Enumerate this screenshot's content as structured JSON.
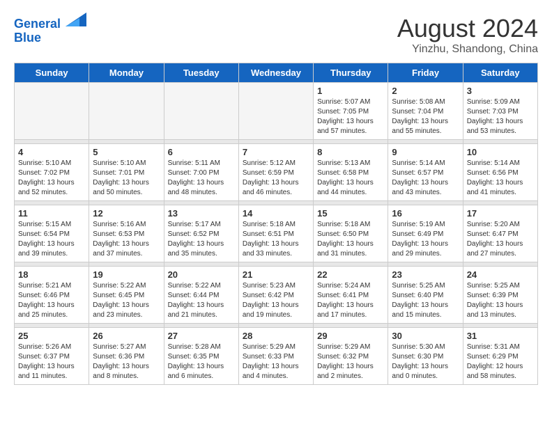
{
  "header": {
    "logo_line1": "General",
    "logo_line2": "Blue",
    "main_title": "August 2024",
    "subtitle": "Yinzhu, Shandong, China"
  },
  "weekdays": [
    "Sunday",
    "Monday",
    "Tuesday",
    "Wednesday",
    "Thursday",
    "Friday",
    "Saturday"
  ],
  "weeks": [
    [
      {
        "num": "",
        "empty": true
      },
      {
        "num": "",
        "empty": true
      },
      {
        "num": "",
        "empty": true
      },
      {
        "num": "",
        "empty": true
      },
      {
        "num": "1",
        "sunrise": "5:07 AM",
        "sunset": "7:05 PM",
        "daylight": "13 hours and 57 minutes."
      },
      {
        "num": "2",
        "sunrise": "5:08 AM",
        "sunset": "7:04 PM",
        "daylight": "13 hours and 55 minutes."
      },
      {
        "num": "3",
        "sunrise": "5:09 AM",
        "sunset": "7:03 PM",
        "daylight": "13 hours and 53 minutes."
      }
    ],
    [
      {
        "num": "4",
        "sunrise": "5:10 AM",
        "sunset": "7:02 PM",
        "daylight": "13 hours and 52 minutes."
      },
      {
        "num": "5",
        "sunrise": "5:10 AM",
        "sunset": "7:01 PM",
        "daylight": "13 hours and 50 minutes."
      },
      {
        "num": "6",
        "sunrise": "5:11 AM",
        "sunset": "7:00 PM",
        "daylight": "13 hours and 48 minutes."
      },
      {
        "num": "7",
        "sunrise": "5:12 AM",
        "sunset": "6:59 PM",
        "daylight": "13 hours and 46 minutes."
      },
      {
        "num": "8",
        "sunrise": "5:13 AM",
        "sunset": "6:58 PM",
        "daylight": "13 hours and 44 minutes."
      },
      {
        "num": "9",
        "sunrise": "5:14 AM",
        "sunset": "6:57 PM",
        "daylight": "13 hours and 43 minutes."
      },
      {
        "num": "10",
        "sunrise": "5:14 AM",
        "sunset": "6:56 PM",
        "daylight": "13 hours and 41 minutes."
      }
    ],
    [
      {
        "num": "11",
        "sunrise": "5:15 AM",
        "sunset": "6:54 PM",
        "daylight": "13 hours and 39 minutes."
      },
      {
        "num": "12",
        "sunrise": "5:16 AM",
        "sunset": "6:53 PM",
        "daylight": "13 hours and 37 minutes."
      },
      {
        "num": "13",
        "sunrise": "5:17 AM",
        "sunset": "6:52 PM",
        "daylight": "13 hours and 35 minutes."
      },
      {
        "num": "14",
        "sunrise": "5:18 AM",
        "sunset": "6:51 PM",
        "daylight": "13 hours and 33 minutes."
      },
      {
        "num": "15",
        "sunrise": "5:18 AM",
        "sunset": "6:50 PM",
        "daylight": "13 hours and 31 minutes."
      },
      {
        "num": "16",
        "sunrise": "5:19 AM",
        "sunset": "6:49 PM",
        "daylight": "13 hours and 29 minutes."
      },
      {
        "num": "17",
        "sunrise": "5:20 AM",
        "sunset": "6:47 PM",
        "daylight": "13 hours and 27 minutes."
      }
    ],
    [
      {
        "num": "18",
        "sunrise": "5:21 AM",
        "sunset": "6:46 PM",
        "daylight": "13 hours and 25 minutes."
      },
      {
        "num": "19",
        "sunrise": "5:22 AM",
        "sunset": "6:45 PM",
        "daylight": "13 hours and 23 minutes."
      },
      {
        "num": "20",
        "sunrise": "5:22 AM",
        "sunset": "6:44 PM",
        "daylight": "13 hours and 21 minutes."
      },
      {
        "num": "21",
        "sunrise": "5:23 AM",
        "sunset": "6:42 PM",
        "daylight": "13 hours and 19 minutes."
      },
      {
        "num": "22",
        "sunrise": "5:24 AM",
        "sunset": "6:41 PM",
        "daylight": "13 hours and 17 minutes."
      },
      {
        "num": "23",
        "sunrise": "5:25 AM",
        "sunset": "6:40 PM",
        "daylight": "13 hours and 15 minutes."
      },
      {
        "num": "24",
        "sunrise": "5:25 AM",
        "sunset": "6:39 PM",
        "daylight": "13 hours and 13 minutes."
      }
    ],
    [
      {
        "num": "25",
        "sunrise": "5:26 AM",
        "sunset": "6:37 PM",
        "daylight": "13 hours and 11 minutes."
      },
      {
        "num": "26",
        "sunrise": "5:27 AM",
        "sunset": "6:36 PM",
        "daylight": "13 hours and 8 minutes."
      },
      {
        "num": "27",
        "sunrise": "5:28 AM",
        "sunset": "6:35 PM",
        "daylight": "13 hours and 6 minutes."
      },
      {
        "num": "28",
        "sunrise": "5:29 AM",
        "sunset": "6:33 PM",
        "daylight": "13 hours and 4 minutes."
      },
      {
        "num": "29",
        "sunrise": "5:29 AM",
        "sunset": "6:32 PM",
        "daylight": "13 hours and 2 minutes."
      },
      {
        "num": "30",
        "sunrise": "5:30 AM",
        "sunset": "6:30 PM",
        "daylight": "13 hours and 0 minutes."
      },
      {
        "num": "31",
        "sunrise": "5:31 AM",
        "sunset": "6:29 PM",
        "daylight": "12 hours and 58 minutes."
      }
    ]
  ]
}
